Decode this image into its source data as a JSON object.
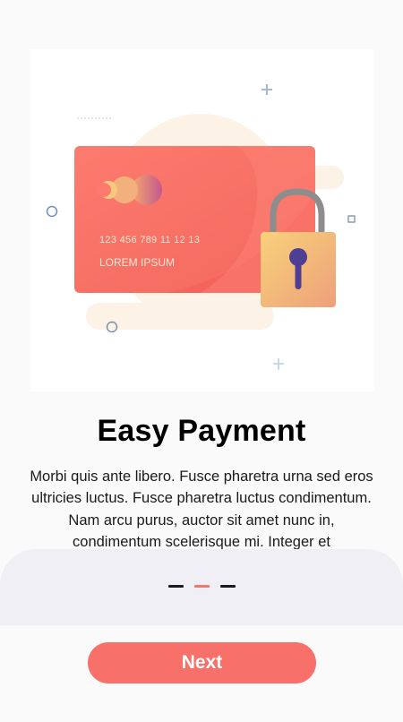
{
  "onboarding": {
    "title": "Easy Payment",
    "description": "Morbi quis ante libero. Fusce pharetra urna sed eros ultricies luctus. Fusce pharetra luctus condimentum. Nam arcu purus, auctor sit amet nunc in, condimentum scelerisque mi. Integer et",
    "illustration": {
      "card_number": "123 456 789 11 12 13",
      "card_holder": "LOREM IPSUM"
    },
    "page_indicator": {
      "count": 3,
      "active_index": 1
    },
    "next_label": "Next"
  },
  "colors": {
    "accent": "#f8706a",
    "indicator_active": "#f87666",
    "indicator_inactive": "#1b1b1b",
    "sheet_background": "#f1eff6"
  }
}
